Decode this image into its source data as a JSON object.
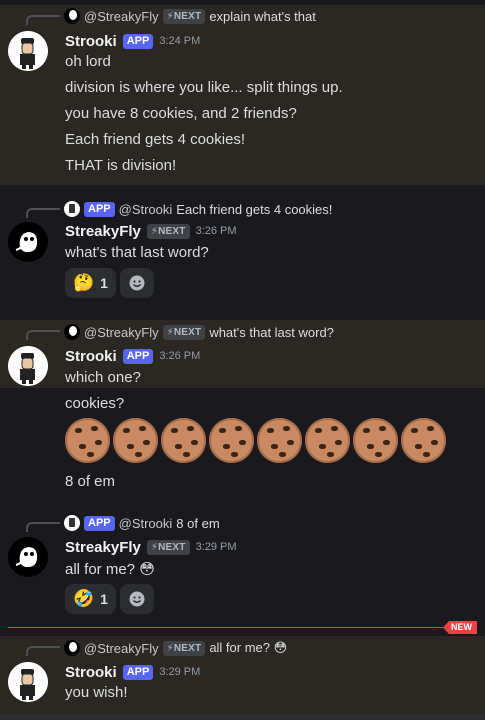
{
  "messages": [
    {
      "reply": {
        "name": "@StreakyFly",
        "badge": "⚡NEXT",
        "text": "explain what's that"
      },
      "author": "Strooki",
      "badge": "APP",
      "time": "3:24 PM",
      "lines": [
        "oh lord",
        "division is where you like... split things up.",
        "you have 8 cookies, and 2 friends?",
        "Each friend gets 4 cookies!",
        "THAT is division!"
      ]
    },
    {
      "reply": {
        "badge": "APP",
        "name": "@Strooki",
        "text": "Each friend gets 4 cookies!"
      },
      "author": "StreakyFly",
      "badge": "⚡NEXT",
      "time": "3:26 PM",
      "lines": [
        "what's that last word?"
      ],
      "reactions": [
        {
          "emoji": "🤔",
          "count": "1"
        }
      ]
    },
    {
      "reply": {
        "name": "@StreakyFly",
        "badge": "⚡NEXT",
        "text": "what's that last word?"
      },
      "author": "Strooki",
      "badge": "APP",
      "time": "3:26 PM",
      "lines": [
        "which one?",
        "cookies?",
        "8 of em"
      ],
      "cookies": [
        "cookie",
        "cookie",
        "cookie",
        "cookie",
        "cookie",
        "cookie",
        "cookie",
        "cookie"
      ]
    },
    {
      "reply": {
        "badge": "APP",
        "name": "@Strooki",
        "text": "8 of em"
      },
      "author": "StreakyFly",
      "badge": "⚡NEXT",
      "time": "3:29 PM",
      "lines": [
        "all for me? 😳"
      ],
      "reactions": [
        {
          "emoji": "🤣",
          "count": "1"
        }
      ]
    },
    {
      "reply": {
        "name": "@StreakyFly",
        "badge": "⚡NEXT",
        "text": "all for me? 😳"
      },
      "author": "Strooki",
      "badge": "APP",
      "time": "3:29 PM",
      "lines": [
        "you wish!"
      ]
    }
  ],
  "divider": {
    "label": "NEW",
    "color": "#f23f43"
  },
  "colors": {
    "background": "#1a1a1e",
    "highlight": "#2b2722",
    "app_badge": "#5865f2",
    "mention_bg": "#3f4147"
  },
  "icons": {
    "add_reaction": "smiley-add-icon",
    "avatar_strooki": "cartoon-character-avatar",
    "avatar_streaky": "ghost-avatar"
  }
}
